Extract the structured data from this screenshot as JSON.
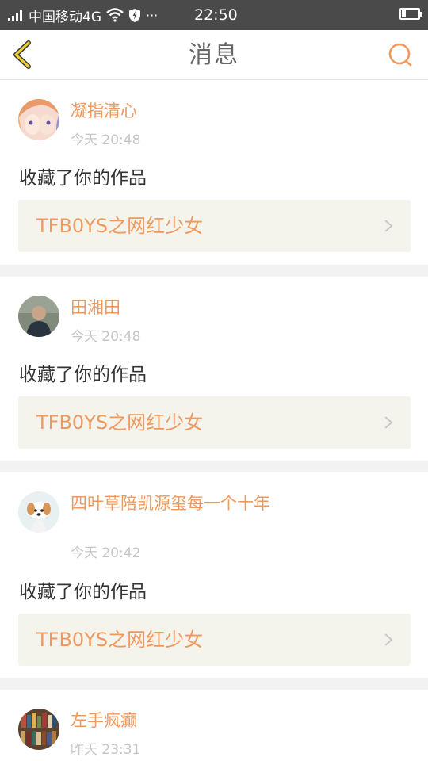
{
  "status_bar": {
    "carrier": "中国移动4G",
    "time": "22:50",
    "battery_level": 0.25,
    "icons": [
      "signal-icon",
      "wifi-icon",
      "shield-icon",
      "more-icon",
      "battery-icon"
    ],
    "more": "···"
  },
  "nav": {
    "title": "消息",
    "back_icon": "chevron-left-icon",
    "search_icon": "search-icon"
  },
  "messages": [
    {
      "user": "凝指清心",
      "time": "今天 20:48",
      "action": "收藏了你的作品",
      "work": "TFB0YS之网红少女"
    },
    {
      "user": "田湘田",
      "time": "今天 20:48",
      "action": "收藏了你的作品",
      "work": "TFB0YS之网红少女"
    },
    {
      "user": "四叶草陪凯源玺每一个十年",
      "time": "今天 20:42",
      "action": "收藏了你的作品",
      "work": "TFB0YS之网红少女"
    },
    {
      "user": "左手疯癫",
      "time": "昨天 23:31",
      "action": "",
      "work": ""
    }
  ],
  "colors": {
    "accent": "#f0995e",
    "status_bar": "#4a4a4a",
    "link_bg": "#f4f3ec",
    "divider": "#f2f2f2"
  }
}
